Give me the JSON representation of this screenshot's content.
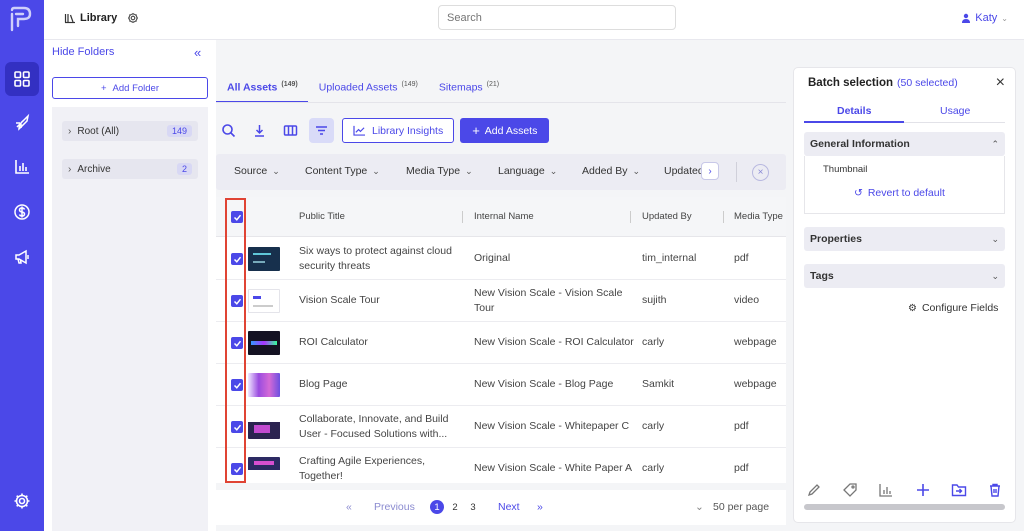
{
  "app": {
    "library_title": "Library",
    "search_placeholder": "Search",
    "user_name": "Katy"
  },
  "rail": {
    "items": [
      "grid-icon",
      "rocket-icon",
      "chart-icon",
      "dollar-icon",
      "megaphone-icon",
      "settings-icon"
    ],
    "active": "grid-icon",
    "accent": "#4b48e8"
  },
  "folders": {
    "hide_label": "Hide Folders",
    "add_label": "Add Folder",
    "items": [
      {
        "label": "Root (All)",
        "count": "149"
      },
      {
        "label": "Archive",
        "count": "2"
      }
    ]
  },
  "tabs": [
    {
      "label": "All Assets",
      "count": "(149)",
      "active": true
    },
    {
      "label": "Uploaded Assets",
      "count": "(149)",
      "active": false
    },
    {
      "label": "Sitemaps",
      "count": "(21)",
      "active": false
    }
  ],
  "toolbar": {
    "insights_label": "Library Insights",
    "add_assets_label": "Add Assets"
  },
  "filters": [
    "Source",
    "Content Type",
    "Media Type",
    "Language",
    "Added By",
    "Updated"
  ],
  "table": {
    "columns": [
      "Public Title",
      "Internal Name",
      "Updated By",
      "Media Type"
    ],
    "rows": [
      {
        "public_title": "Six ways to protect against cloud security threats",
        "internal_name": "Original",
        "updated_by": "tim_internal",
        "media_type": "pdf"
      },
      {
        "public_title": "Vision Scale Tour",
        "internal_name": "New Vision Scale - Vision Scale Tour",
        "updated_by": "sujith",
        "media_type": "video"
      },
      {
        "public_title": "ROI Calculator",
        "internal_name": "New Vision Scale - ROI Calculator",
        "updated_by": "carly",
        "media_type": "webpage"
      },
      {
        "public_title": "Blog Page",
        "internal_name": "New Vision Scale - Blog Page",
        "updated_by": "Samkit",
        "media_type": "webpage"
      },
      {
        "public_title": "Collaborate, Innovate, and Build User - Focused Solutions with...",
        "internal_name": "New Vision Scale - Whitepaper C",
        "updated_by": "carly",
        "media_type": "pdf"
      },
      {
        "public_title": "Crafting Agile Experiences, Together!",
        "internal_name": "New Vision Scale - White Paper A",
        "updated_by": "carly",
        "media_type": "pdf"
      }
    ]
  },
  "pager": {
    "previous": "Previous",
    "pages": [
      "1",
      "2",
      "3"
    ],
    "current": "1",
    "next": "Next",
    "per_page": "50 per page"
  },
  "batch": {
    "title": "Batch selection",
    "selected": "(50 selected)",
    "tab_details": "Details",
    "tab_usage": "Usage",
    "general_info": "General Information",
    "thumbnail_label": "Thumbnail",
    "revert_label": "Revert to default",
    "properties": "Properties",
    "tags": "Tags",
    "configure_label": "Configure Fields",
    "actions": [
      "pencil-icon",
      "tag-icon",
      "bar-chart-icon",
      "plus-icon",
      "folder-move-icon",
      "trash-icon"
    ]
  }
}
